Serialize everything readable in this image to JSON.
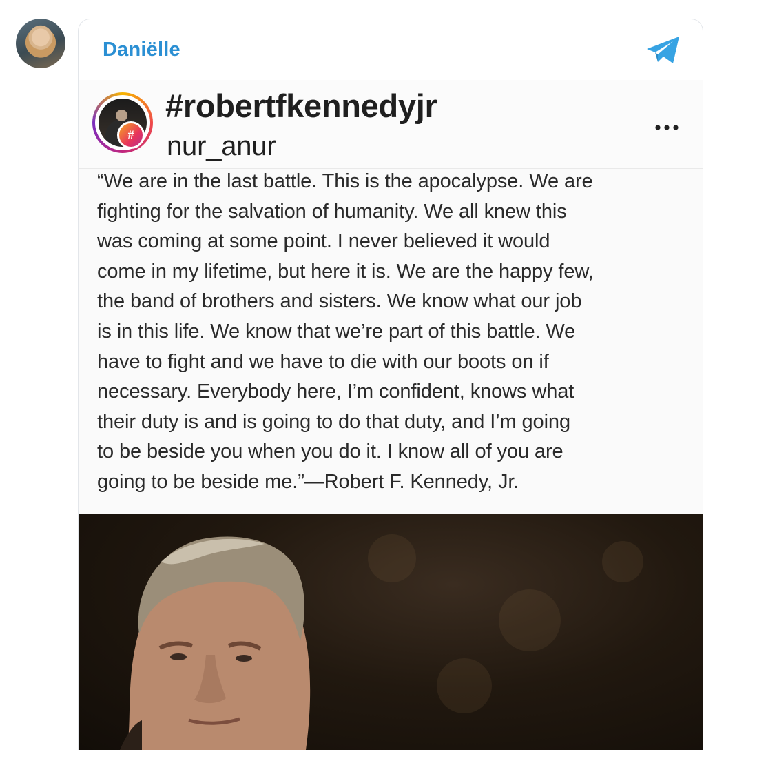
{
  "message": {
    "sender_name": "Daniëlle",
    "share_icon": "telegram-send-icon"
  },
  "post": {
    "hashtag": "#robertfkennedyjr",
    "username": "nur_anur",
    "badge_symbol": "#",
    "more_icon": "more-dots-icon",
    "quote_lines": [
      "“We are in the last battle. This is the apocalypse. We are",
      "fighting for the salvation of humanity. We all knew this",
      "was coming at some point. I never believed it would",
      "come in my lifetime, but here it is. We are the happy few,",
      "the band of brothers and sisters. We know what our job",
      "is in this life. We know that we’re part of this battle. We",
      "have to fight and we have to die with our boots on if",
      "necessary. Everybody here, I’m confident, knows what",
      "their duty is and is going to do that duty, and I’m going",
      "to be beside you when you do it. I know all of you are",
      "going to be beside me.”—Robert F. Kennedy, Jr."
    ]
  },
  "colors": {
    "sender_blue": "#2b8fd3",
    "telegram_blue": "#37a3e3"
  }
}
